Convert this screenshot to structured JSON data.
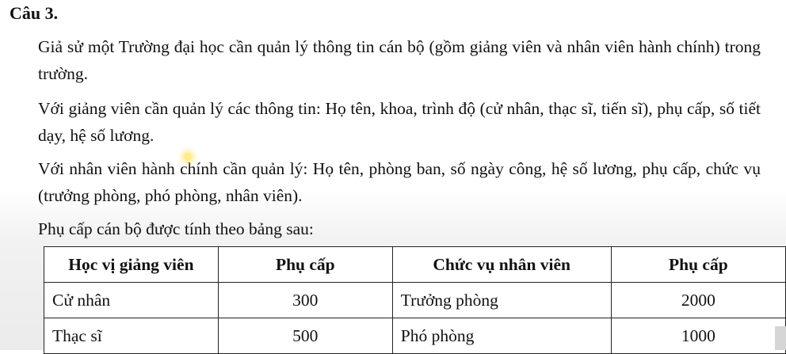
{
  "heading": "Câu 3.",
  "paragraphs": [
    "Giả sử một Trường đại học cần quản lý thông tin cán bộ (gồm giảng viên và nhân viên hành chính) trong trường.",
    "Với giảng viên cần quản lý các thông tin: Họ tên, khoa, trình độ (cử nhân, thạc sĩ, tiến sĩ), phụ cấp, số tiết dạy, hệ số lương.",
    "Với nhân viên hành chính cần quản lý: Họ tên, phòng ban, số ngày công, hệ số lương, phụ cấp, chức vụ (trưởng phòng, phó phòng, nhân viên).",
    "Phụ cấp cán bộ được tính theo bảng sau:"
  ],
  "table": {
    "headers": [
      "Học vị giảng viên",
      "Phụ cấp",
      "Chức vụ nhân viên",
      "Phụ cấp"
    ],
    "rows": [
      [
        "Cử nhân",
        "300",
        "Trưởng phòng",
        "2000"
      ],
      [
        "Thạc sĩ",
        "500",
        "Phó phòng",
        "1000"
      ]
    ]
  }
}
